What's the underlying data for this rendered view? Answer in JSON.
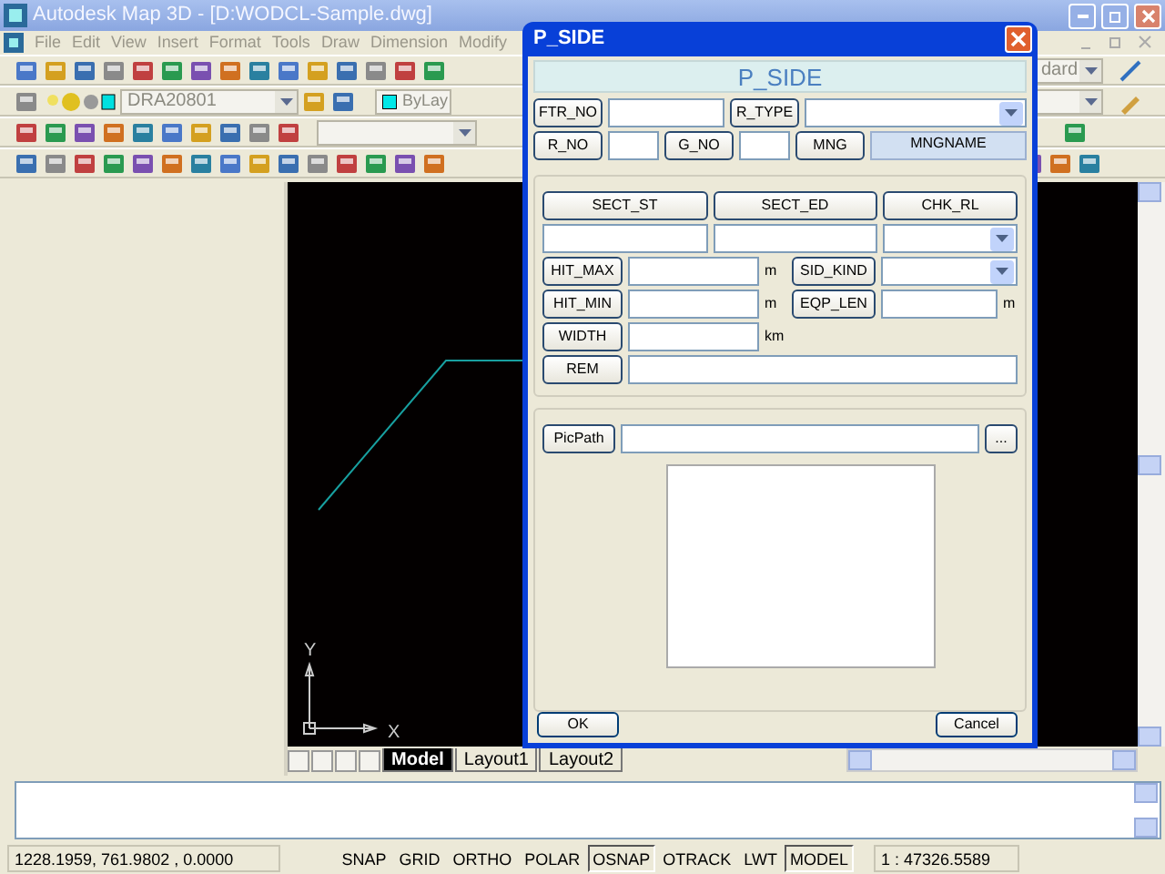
{
  "window": {
    "title": "Autodesk Map 3D - [D:WODCL-Sample.dwg]"
  },
  "menu": [
    "File",
    "Edit",
    "View",
    "Insert",
    "Format",
    "Tools",
    "Draw",
    "Dimension",
    "Modify"
  ],
  "toolbars": {
    "layer_combo": {
      "value": "DRA20801"
    },
    "color_combo": {
      "value": "ByLay"
    },
    "style_combo": {
      "value": "dard"
    }
  },
  "drawing": {
    "ucs": {
      "x_label": "X",
      "y_label": "Y"
    }
  },
  "layout_tabs": [
    {
      "label": "Model",
      "selected": true
    },
    {
      "label": "Layout1",
      "selected": false
    },
    {
      "label": "Layout2",
      "selected": false
    }
  ],
  "status_bar": {
    "coordinates": "1228.1959, 761.9802 , 0.0000",
    "toggles": [
      {
        "label": "SNAP",
        "on": false
      },
      {
        "label": "GRID",
        "on": false
      },
      {
        "label": "ORTHO",
        "on": false
      },
      {
        "label": "POLAR",
        "on": false
      },
      {
        "label": "OSNAP",
        "on": true
      },
      {
        "label": "OTRACK",
        "on": false
      },
      {
        "label": "LWT",
        "on": false
      },
      {
        "label": "MODEL",
        "on": true
      }
    ],
    "scale": "1 : 47326.5589"
  },
  "dialog": {
    "title": "P_SIDE",
    "header": "P_SIDE",
    "sections": [
      {
        "rows": [
          [
            {
              "kind": "button",
              "label": "FTR_NO"
            },
            {
              "kind": "input"
            },
            {
              "kind": "button",
              "label": "R_TYPE"
            },
            {
              "kind": "combo"
            }
          ],
          [
            {
              "kind": "button",
              "label": "R_NO"
            },
            {
              "kind": "input"
            },
            {
              "kind": "button",
              "label": "G_NO"
            },
            {
              "kind": "input"
            },
            {
              "kind": "button",
              "label": "MNG"
            },
            {
              "kind": "label",
              "text": "MNGNAME"
            }
          ]
        ]
      },
      {
        "rows": [
          [
            {
              "kind": "button",
              "label": "SECT_ST"
            },
            {
              "kind": "button",
              "label": "SECT_ED"
            },
            {
              "kind": "button",
              "label": "CHK_RL"
            }
          ],
          [
            {
              "kind": "input"
            },
            {
              "kind": "input"
            },
            {
              "kind": "combo"
            }
          ],
          [
            {
              "kind": "button",
              "label": "HIT_MAX"
            },
            {
              "kind": "input"
            },
            {
              "kind": "unit",
              "text": "m"
            },
            {
              "kind": "button",
              "label": "SID_KIND"
            },
            {
              "kind": "combo"
            }
          ],
          [
            {
              "kind": "button",
              "label": "HIT_MIN"
            },
            {
              "kind": "input"
            },
            {
              "kind": "unit",
              "text": "m"
            },
            {
              "kind": "button",
              "label": "EQP_LEN"
            },
            {
              "kind": "input"
            },
            {
              "kind": "unit",
              "text": "m"
            }
          ],
          [
            {
              "kind": "button",
              "label": "WIDTH"
            },
            {
              "kind": "input"
            },
            {
              "kind": "unit",
              "text": "km"
            }
          ],
          [
            {
              "kind": "button",
              "label": "REM"
            },
            {
              "kind": "input"
            }
          ]
        ]
      },
      {
        "rows": [
          [
            {
              "kind": "button",
              "label": "PicPath"
            },
            {
              "kind": "input"
            },
            {
              "kind": "button",
              "label": "..."
            }
          ]
        ]
      }
    ],
    "buttons": [
      "OK",
      "Cancel"
    ]
  }
}
